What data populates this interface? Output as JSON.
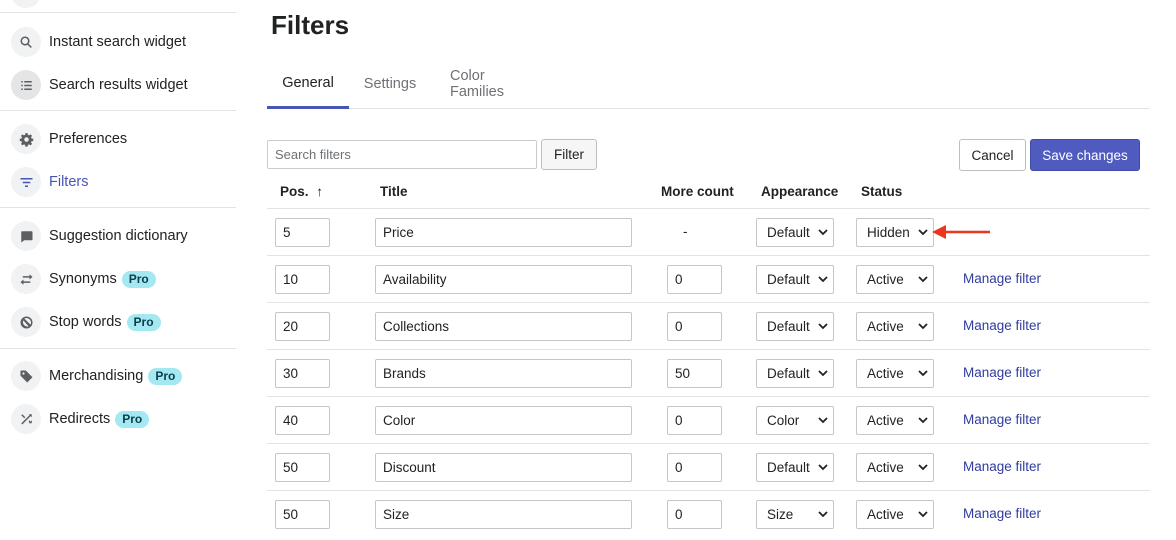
{
  "sidebar": {
    "items": [
      {
        "label": "Instant search widget",
        "icon": "search-icon",
        "pro": false
      },
      {
        "label": "Search results widget",
        "icon": "list-icon",
        "pro": false
      },
      {
        "label": "Preferences",
        "icon": "gear-icon",
        "pro": false
      },
      {
        "label": "Filters",
        "icon": "filter-icon",
        "pro": false
      },
      {
        "label": "Suggestion dictionary",
        "icon": "chat-bubble-icon",
        "pro": false
      },
      {
        "label": "Synonyms",
        "icon": "swap-arrows-icon",
        "pro": true
      },
      {
        "label": "Stop words",
        "icon": "prohibited-icon",
        "pro": true
      },
      {
        "label": "Merchandising",
        "icon": "tag-icon",
        "pro": true
      },
      {
        "label": "Redirects",
        "icon": "shuffle-icon",
        "pro": true
      }
    ],
    "pro_label": "Pro",
    "selected": "Filters"
  },
  "page": {
    "title": "Filters",
    "tabs": [
      {
        "label": "General",
        "active": true
      },
      {
        "label": "Settings",
        "active": false
      },
      {
        "label": "Color Families",
        "active": false
      }
    ]
  },
  "toolbar": {
    "search_placeholder": "Search filters",
    "search_value": "",
    "filter_label": "Filter",
    "cancel_label": "Cancel",
    "save_label": "Save changes"
  },
  "table": {
    "headers": {
      "pos": "Pos.",
      "sort_indicator": "↑",
      "title": "Title",
      "more_count": "More count",
      "appearance": "Appearance",
      "status": "Status"
    },
    "rows": [
      {
        "pos": "5",
        "title": "Price",
        "more_count": "-",
        "appearance": "Default",
        "status": "Hidden",
        "manage": ""
      },
      {
        "pos": "10",
        "title": "Availability",
        "more_count": "0",
        "appearance": "Default",
        "status": "Active",
        "manage": "Manage filter"
      },
      {
        "pos": "20",
        "title": "Collections",
        "more_count": "0",
        "appearance": "Default",
        "status": "Active",
        "manage": "Manage filter"
      },
      {
        "pos": "30",
        "title": "Brands",
        "more_count": "50",
        "appearance": "Default",
        "status": "Active",
        "manage": "Manage filter"
      },
      {
        "pos": "40",
        "title": "Color",
        "more_count": "0",
        "appearance": "Color",
        "status": "Active",
        "manage": "Manage filter"
      },
      {
        "pos": "50",
        "title": "Discount",
        "more_count": "0",
        "appearance": "Default",
        "status": "Active",
        "manage": "Manage filter"
      },
      {
        "pos": "50",
        "title": "Size",
        "more_count": "0",
        "appearance": "Size",
        "status": "Active",
        "manage": "Manage filter"
      }
    ]
  },
  "colors": {
    "accent": "#4756b2",
    "primary_button": "#4f5bbf",
    "pro_badge": "#a4e8f2",
    "link": "#2f3c9e",
    "annotation_arrow": "#e8361f"
  }
}
